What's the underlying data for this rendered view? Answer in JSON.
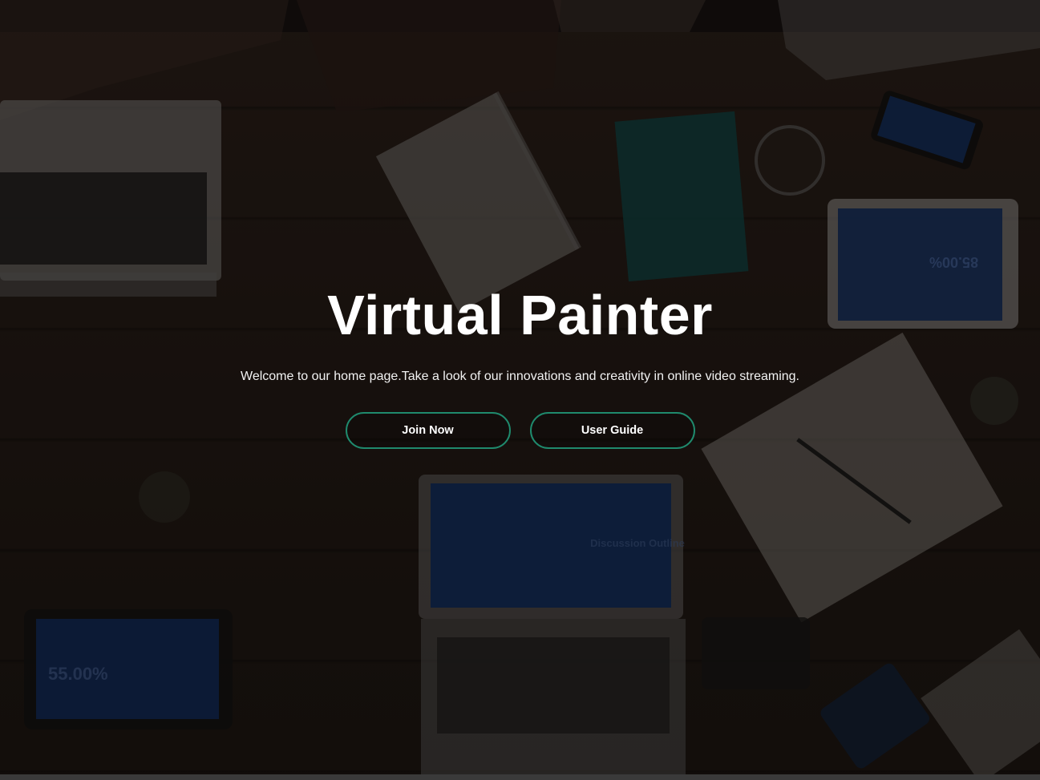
{
  "hero": {
    "title": "Virtual Painter",
    "subtitle": "Welcome to our home page.Take a look of our innovations and creativity in online video streaming.",
    "buttons": [
      {
        "label": "Join Now"
      },
      {
        "label": "User Guide"
      }
    ]
  },
  "background": {
    "laptop_screen_text": "Discussion Outline",
    "tablet_left_text": "55.00%",
    "tablet_right_text": "85.00%"
  },
  "colors": {
    "button_border": "#1f8a6d",
    "title_text": "#ffffff",
    "background": "#241a15"
  }
}
